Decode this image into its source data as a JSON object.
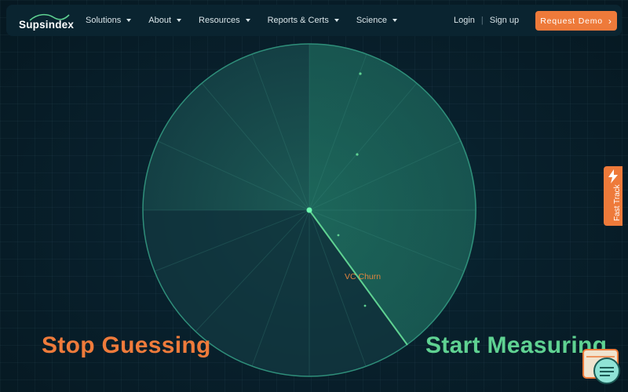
{
  "brand": {
    "name": "Supsindex"
  },
  "nav": {
    "items": [
      {
        "label": "Solutions"
      },
      {
        "label": "About"
      },
      {
        "label": "Resources"
      },
      {
        "label": "Reports & Certs"
      },
      {
        "label": "Science"
      }
    ],
    "login": "Login",
    "signup": "Sign up",
    "demo_button": "Request Demo"
  },
  "radar": {
    "label": "VC Churn"
  },
  "hero": {
    "left": "Stop Guessing",
    "right": "Start Measuring"
  },
  "fast_track": {
    "label": "Fast Track"
  },
  "colors": {
    "accent_orange": "#ee7a3a",
    "accent_green": "#5fd292",
    "background": "#08202c"
  },
  "icons": {
    "nav_caret": "caret-down-icon",
    "demo_chevron": "chevron-right-icon",
    "fast_track": "lightning-bolt-icon",
    "chat": "chat-widget-icon"
  }
}
